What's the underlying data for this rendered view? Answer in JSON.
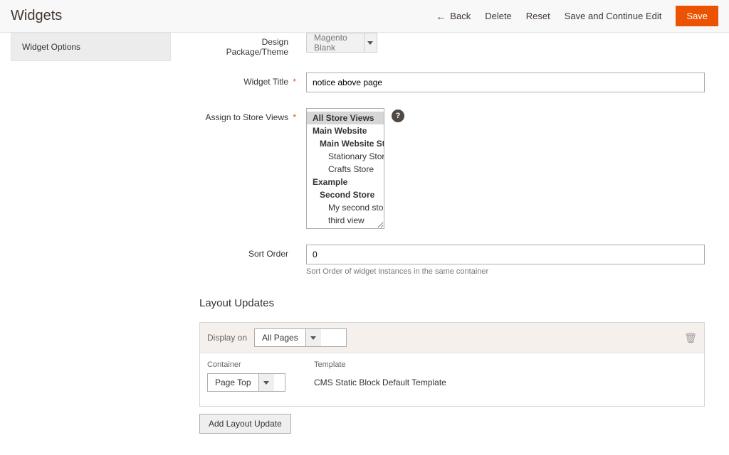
{
  "header": {
    "title": "Widgets",
    "actions": {
      "back": "Back",
      "delete": "Delete",
      "reset": "Reset",
      "save_continue": "Save and Continue Edit",
      "save": "Save"
    }
  },
  "sidebar": {
    "tab_widget_options": "Widget Options"
  },
  "form": {
    "design_theme": {
      "label": "Design Package/Theme",
      "value": "Magento Blank"
    },
    "widget_title": {
      "label": "Widget Title",
      "value": "notice above page"
    },
    "store_views": {
      "label": "Assign to Store Views",
      "options": [
        {
          "label": "All Store Views",
          "level": 0,
          "group": true,
          "selected": true
        },
        {
          "label": "Main Website",
          "level": 0,
          "group": true,
          "selected": false
        },
        {
          "label": "Main Website Store",
          "level": 1,
          "group": true,
          "selected": false
        },
        {
          "label": "Stationary Store",
          "level": 2,
          "group": false,
          "selected": false
        },
        {
          "label": "Crafts Store",
          "level": 2,
          "group": false,
          "selected": false
        },
        {
          "label": "Example",
          "level": 0,
          "group": true,
          "selected": false
        },
        {
          "label": "Second Store",
          "level": 1,
          "group": true,
          "selected": false
        },
        {
          "label": "My second store",
          "level": 2,
          "group": false,
          "selected": false
        },
        {
          "label": "third view",
          "level": 2,
          "group": false,
          "selected": false
        }
      ]
    },
    "sort_order": {
      "label": "Sort Order",
      "value": "0",
      "hint": "Sort Order of widget instances in the same container"
    }
  },
  "layout": {
    "section_title": "Layout Updates",
    "display_on_label": "Display on",
    "display_on_value": "All Pages",
    "container_label": "Container",
    "container_value": "Page Top",
    "template_label": "Template",
    "template_value": "CMS Static Block Default Template",
    "add_button": "Add Layout Update"
  }
}
